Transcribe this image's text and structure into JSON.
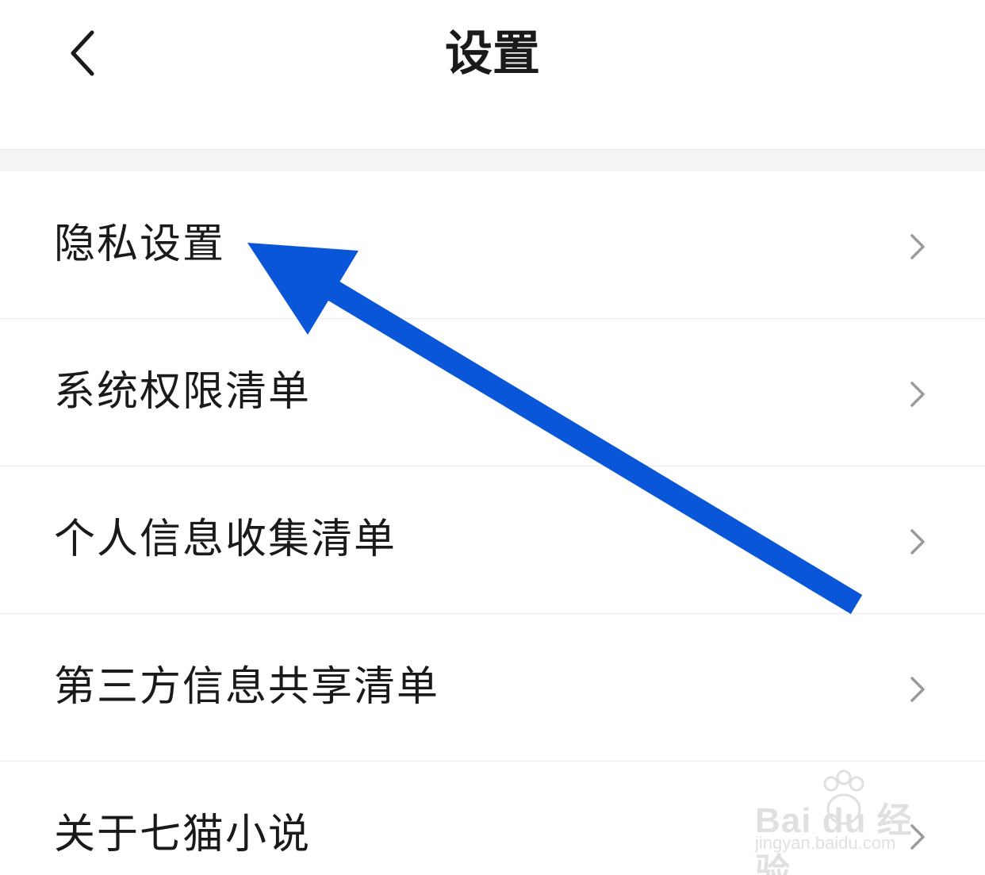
{
  "header": {
    "title": "设置",
    "back_icon": "chevron-left-icon"
  },
  "menu": {
    "items": [
      {
        "label": "隐私设置"
      },
      {
        "label": "系统权限清单"
      },
      {
        "label": "个人信息收集清单"
      },
      {
        "label": "第三方信息共享清单"
      },
      {
        "label": "关于七猫小说"
      }
    ],
    "item_icon": "chevron-right-icon"
  },
  "annotation": {
    "color": "#0a56d8"
  },
  "watermark": {
    "logo": "Bai  du 经验",
    "url": "jingyan.baidu.com"
  },
  "colors": {
    "background": "#ffffff",
    "divider": "#ececec",
    "section_gap": "#f4f4f4",
    "text": "#1a1a1a",
    "chevron": "#9a9a9a"
  }
}
